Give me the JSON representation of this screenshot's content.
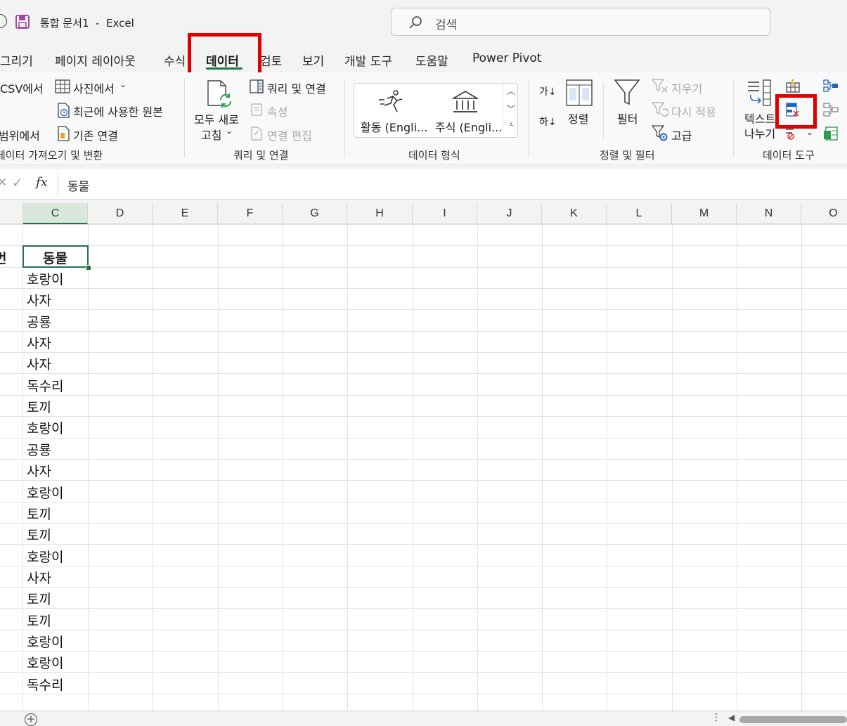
{
  "title_bar": {
    "doc_title": "통합 문서1  -  Excel",
    "search_placeholder": "검색"
  },
  "tabs": [
    {
      "label": "그리기"
    },
    {
      "label": "페이지 레이아웃"
    },
    {
      "label": "수식"
    },
    {
      "label": "데이터",
      "active": true
    },
    {
      "label": "검토"
    },
    {
      "label": "보기"
    },
    {
      "label": "개발 도구"
    },
    {
      "label": "도움말"
    },
    {
      "label": "Power Pivot"
    }
  ],
  "ribbon": {
    "get_transform": {
      "from_csv": "CSV에서",
      "from_picture": "사진에서",
      "from_range": "범위에서",
      "recent_sources": "최근에 사용한 원본",
      "existing_connections": "기존 연결",
      "group_label": "데이터 가져오기 및 변환"
    },
    "queries": {
      "refresh_all_line1": "모두 새로",
      "refresh_all_line2": "고침",
      "queries_connections": "쿼리 및 연결",
      "properties": "속성",
      "edit_links": "연결 편집",
      "group_label": "쿼리 및 연결"
    },
    "data_types": {
      "stocks_activity": "활동 (Engli...",
      "stocks": "주식 (Engli...",
      "group_label": "데이터 형식"
    },
    "sort_filter": {
      "sort": "정렬",
      "filter": "필터",
      "clear": "지우기",
      "reapply": "다시 적용",
      "advanced": "고급",
      "group_label": "정렬 및 필터",
      "sort_az": "가↓",
      "sort_za": "하↓"
    },
    "data_tools": {
      "text_to_columns_line1": "텍스트",
      "text_to_columns_line2": "나누기",
      "group_label": "데이터 도구"
    }
  },
  "formula_bar": {
    "fx": "fx",
    "value": "동물"
  },
  "columns": [
    "C",
    "D",
    "E",
    "F",
    "G",
    "H",
    "I",
    "J",
    "K",
    "L",
    "M",
    "N",
    "O"
  ],
  "cells": {
    "b_partial": "번",
    "header": "동물",
    "values": [
      "호랑이",
      "사자",
      "공룡",
      "사자",
      "사자",
      "독수리",
      "토끼",
      "호랑이",
      "공룡",
      "사자",
      "호랑이",
      "토끼",
      "토끼",
      "호랑이",
      "사자",
      "토끼",
      "토끼",
      "호랑이",
      "호랑이",
      "독수리"
    ]
  },
  "colors": {
    "accent": "#217346",
    "highlight": "#e00000"
  }
}
